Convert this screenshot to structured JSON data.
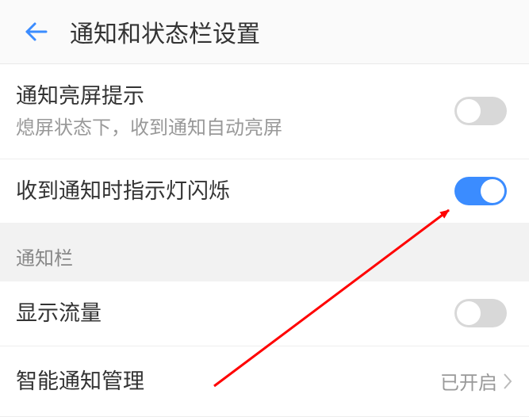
{
  "header": {
    "title": "通知和状态栏设置"
  },
  "settings": {
    "wake_on_notification": {
      "label": "通知亮屏提示",
      "sublabel": "熄屏状态下，收到通知自动亮屏",
      "enabled": false
    },
    "led_flash": {
      "label": "收到通知时指示灯闪烁",
      "enabled": true
    }
  },
  "section": {
    "notification_bar": "通知栏"
  },
  "settings2": {
    "show_traffic": {
      "label": "显示流量",
      "enabled": false
    },
    "smart_notification": {
      "label": "智能通知管理",
      "value": "已开启"
    }
  },
  "colors": {
    "accent": "#3b8cff",
    "arrow": "#ff0000"
  }
}
